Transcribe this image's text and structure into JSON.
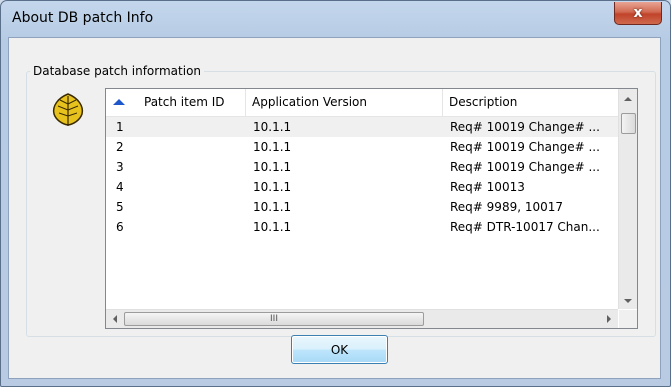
{
  "window": {
    "title": "About DB patch Info",
    "close_label": "x"
  },
  "group": {
    "label": "Database patch information",
    "icon": "leaf-icon"
  },
  "table": {
    "columns": [
      "Patch item ID",
      "Application Version",
      "Description"
    ],
    "sort_column": "Patch item ID",
    "sort_direction": "ascending",
    "rows": [
      [
        "1",
        "10.1.1",
        "Req# 10019 Change# ..."
      ],
      [
        "2",
        "10.1.1",
        "Req# 10019 Change# ..."
      ],
      [
        "3",
        "10.1.1",
        "Req# 10019 Change# ..."
      ],
      [
        "4",
        "10.1.1",
        "Req# 10013"
      ],
      [
        "5",
        "10.1.1",
        "Req# 9989, 10017"
      ],
      [
        "6",
        "10.1.1",
        "Req# DTR-10017 Chan..."
      ]
    ],
    "selected_row": 0,
    "hscroll_grip": "III"
  },
  "buttons": {
    "ok_label": "OK"
  },
  "colors": {
    "close_button": "#c8472f",
    "sort_arrow": "#1e57c9",
    "leaf": "#e8c21c"
  }
}
